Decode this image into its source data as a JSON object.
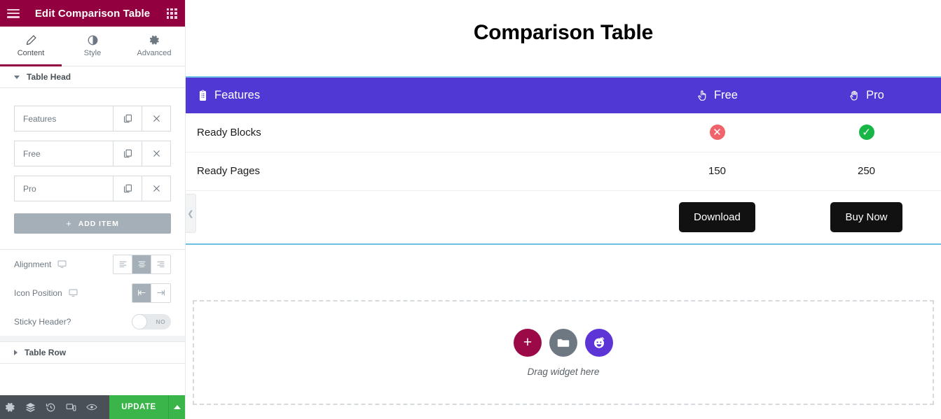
{
  "panel": {
    "header": {
      "title": "Edit Comparison Table",
      "menu_icon": "hamburger-menu-icon",
      "widgets_icon": "widgets-grid-icon"
    },
    "tabs": [
      {
        "label": "Content",
        "icon": "pencil-icon",
        "active": true
      },
      {
        "label": "Style",
        "icon": "half-circle-contrast-icon",
        "active": false
      },
      {
        "label": "Advanced",
        "icon": "gear-icon",
        "active": false
      }
    ],
    "sections": [
      {
        "label": "Table Head",
        "expanded": true
      },
      {
        "label": "Table Row",
        "expanded": false
      }
    ],
    "repeater_items": [
      {
        "title": "Features",
        "duplicate_icon": "copy-icon",
        "remove_icon": "close-x-icon"
      },
      {
        "title": "Free",
        "duplicate_icon": "copy-icon",
        "remove_icon": "close-x-icon"
      },
      {
        "title": "Pro",
        "duplicate_icon": "copy-icon",
        "remove_icon": "close-x-icon"
      }
    ],
    "add_item_label": "ADD ITEM",
    "controls": {
      "alignment": {
        "label": "Alignment",
        "device_icon": "desktop-icon",
        "options": [
          "align-left",
          "align-center",
          "align-right"
        ],
        "selected": "align-center"
      },
      "icon_position": {
        "label": "Icon Position",
        "device_icon": "desktop-icon",
        "options": [
          "icon-before",
          "icon-after"
        ],
        "selected": "icon-before"
      },
      "sticky_header": {
        "label": "Sticky Header?",
        "value": "NO",
        "on": false
      }
    },
    "footer": {
      "icons": [
        "settings-gear-icon",
        "navigator-layers-icon",
        "history-icon",
        "responsive-mode-icon",
        "preview-eye-icon"
      ],
      "update_label": "UPDATE",
      "update_arrow_icon": "caret-up-icon"
    },
    "collapse_handle_icon": "chevron-left-icon"
  },
  "preview": {
    "page_title": "Comparison Table",
    "table": {
      "head": [
        {
          "label": "Features",
          "icon": "clipboard-list-icon",
          "align": "left"
        },
        {
          "label": "Free",
          "icon": "pointing-hand-icon",
          "align": "center"
        },
        {
          "label": "Pro",
          "icon": "open-hand-icon",
          "align": "center"
        }
      ],
      "rows": [
        {
          "feature": "Ready Blocks",
          "free": {
            "type": "badge-no",
            "text": "✕"
          },
          "pro": {
            "type": "badge-yes",
            "text": "✓"
          }
        },
        {
          "feature": "Ready Pages",
          "free": {
            "type": "text",
            "text": "150"
          },
          "pro": {
            "type": "text",
            "text": "250"
          }
        }
      ],
      "footer": {
        "free_button": "Download",
        "pro_button": "Buy Now"
      }
    },
    "dropzone": {
      "text": "Drag widget here",
      "buttons": [
        {
          "icon": "plus-icon",
          "name": "add-new-section"
        },
        {
          "icon": "folder-icon",
          "name": "add-template"
        },
        {
          "icon": "ai-face-icon",
          "name": "ai-builder"
        }
      ]
    }
  },
  "colors": {
    "brand_maroon": "#93003f",
    "table_header_purple": "#5038d4",
    "selection_blue": "#6ec1e4",
    "update_green": "#39b54a",
    "badge_no_red": "#f1636a",
    "badge_yes_green": "#18b646",
    "cta_black": "#111111"
  }
}
